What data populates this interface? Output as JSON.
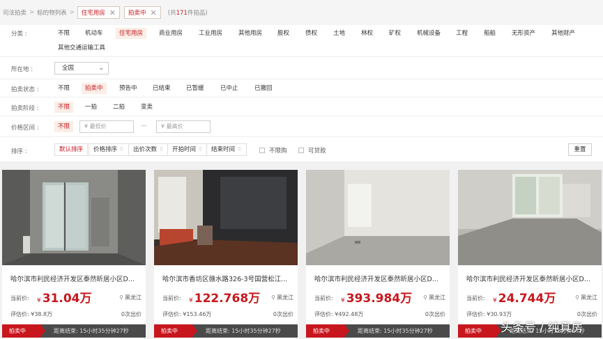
{
  "breadcrumb": {
    "root": "司法拍卖",
    "sep": ">",
    "current": "标的物列表",
    "tags": [
      "住宅用房",
      "拍卖中"
    ],
    "count_prefix": "(共",
    "count_value": "171",
    "count_suffix": "件拍品)"
  },
  "filters": {
    "category": {
      "label": "分类 :",
      "options": [
        "不限",
        "机动车",
        "住宅用房",
        "商业用房",
        "工业用房",
        "其他用房",
        "股权",
        "债权",
        "土地",
        "林权",
        "矿权",
        "机械设备",
        "工程",
        "船舶",
        "无形资产",
        "其他财产",
        "其他交通运输工具"
      ],
      "selected": "住宅用房"
    },
    "location": {
      "label": "所在地 :",
      "value": "全国"
    },
    "status": {
      "label": "拍卖状态 :",
      "options": [
        "不限",
        "拍卖中",
        "预告中",
        "已结束",
        "已暂缓",
        "已中止",
        "已撤回"
      ],
      "selected": "拍卖中"
    },
    "stage": {
      "label": "拍卖阶段 :",
      "options": [
        "不限",
        "一拍",
        "二拍",
        "变卖"
      ],
      "selected": "不限"
    },
    "price": {
      "label": "价格区间 :",
      "unlimited": "不限",
      "min_placeholder": "¥ 最低价",
      "dash": "—",
      "max_placeholder": "¥ 最高价"
    },
    "sort": {
      "label": "排序 :",
      "buttons": [
        "默认排序",
        "价格排序",
        "出价次数",
        "开拍时间",
        "结束时间"
      ],
      "arrow": "⇧",
      "checkboxes": [
        "不限购",
        "可贷款"
      ],
      "reset": "重置"
    }
  },
  "cards": [
    {
      "title": "哈尔滨市利民经济开发区泰然昕居小区D...",
      "price_label": "当前价:",
      "currency": "¥",
      "price": "31.04万",
      "location": "黑龙江",
      "estimate": "评估价: ¥38.8万",
      "bids": "0次出价",
      "status": "拍卖中",
      "countdown": "距离结束: 15小时35分钟27秒"
    },
    {
      "title": "哈尔滨市香坊区赣水路326-3号国营松江...",
      "price_label": "当前价:",
      "currency": "¥",
      "price": "122.768万",
      "location": "黑龙江",
      "estimate": "评估价: ¥153.46万",
      "bids": "0次出价",
      "status": "拍卖中",
      "countdown": "距离结束: 15小时35分钟27秒"
    },
    {
      "title": "哈尔滨市利民经济开发区泰然昕居小区D...",
      "price_label": "当前价:",
      "currency": "¥",
      "price": "393.984万",
      "location": "黑龙江",
      "estimate": "评估价: ¥492.48万",
      "bids": "0次出价",
      "status": "拍卖中",
      "countdown": "距离结束: 15小时35分钟27秒"
    },
    {
      "title": "哈尔滨市利民经济开发区泰然昕居小区D...",
      "price_label": "当前价:",
      "currency": "¥",
      "price": "24.744万",
      "location": "黑龙江",
      "estimate": "评估价: ¥30.93万",
      "bids": "0次出价",
      "status": "拍卖中",
      "countdown": "距离结束: 15小时35分钟27秒"
    }
  ],
  "watermark": "头条号 / 纯真房",
  "colors": {
    "accent": "#c8161d",
    "selected_bg": "#fbeee6",
    "band": "#f1f1f1",
    "timer_bar": "#4a4a4a"
  },
  "icons": {
    "tag_remove": "close-icon",
    "select": "chevron-down-icon",
    "location": "map-pin-icon",
    "sort": "arrow-up-icon"
  }
}
